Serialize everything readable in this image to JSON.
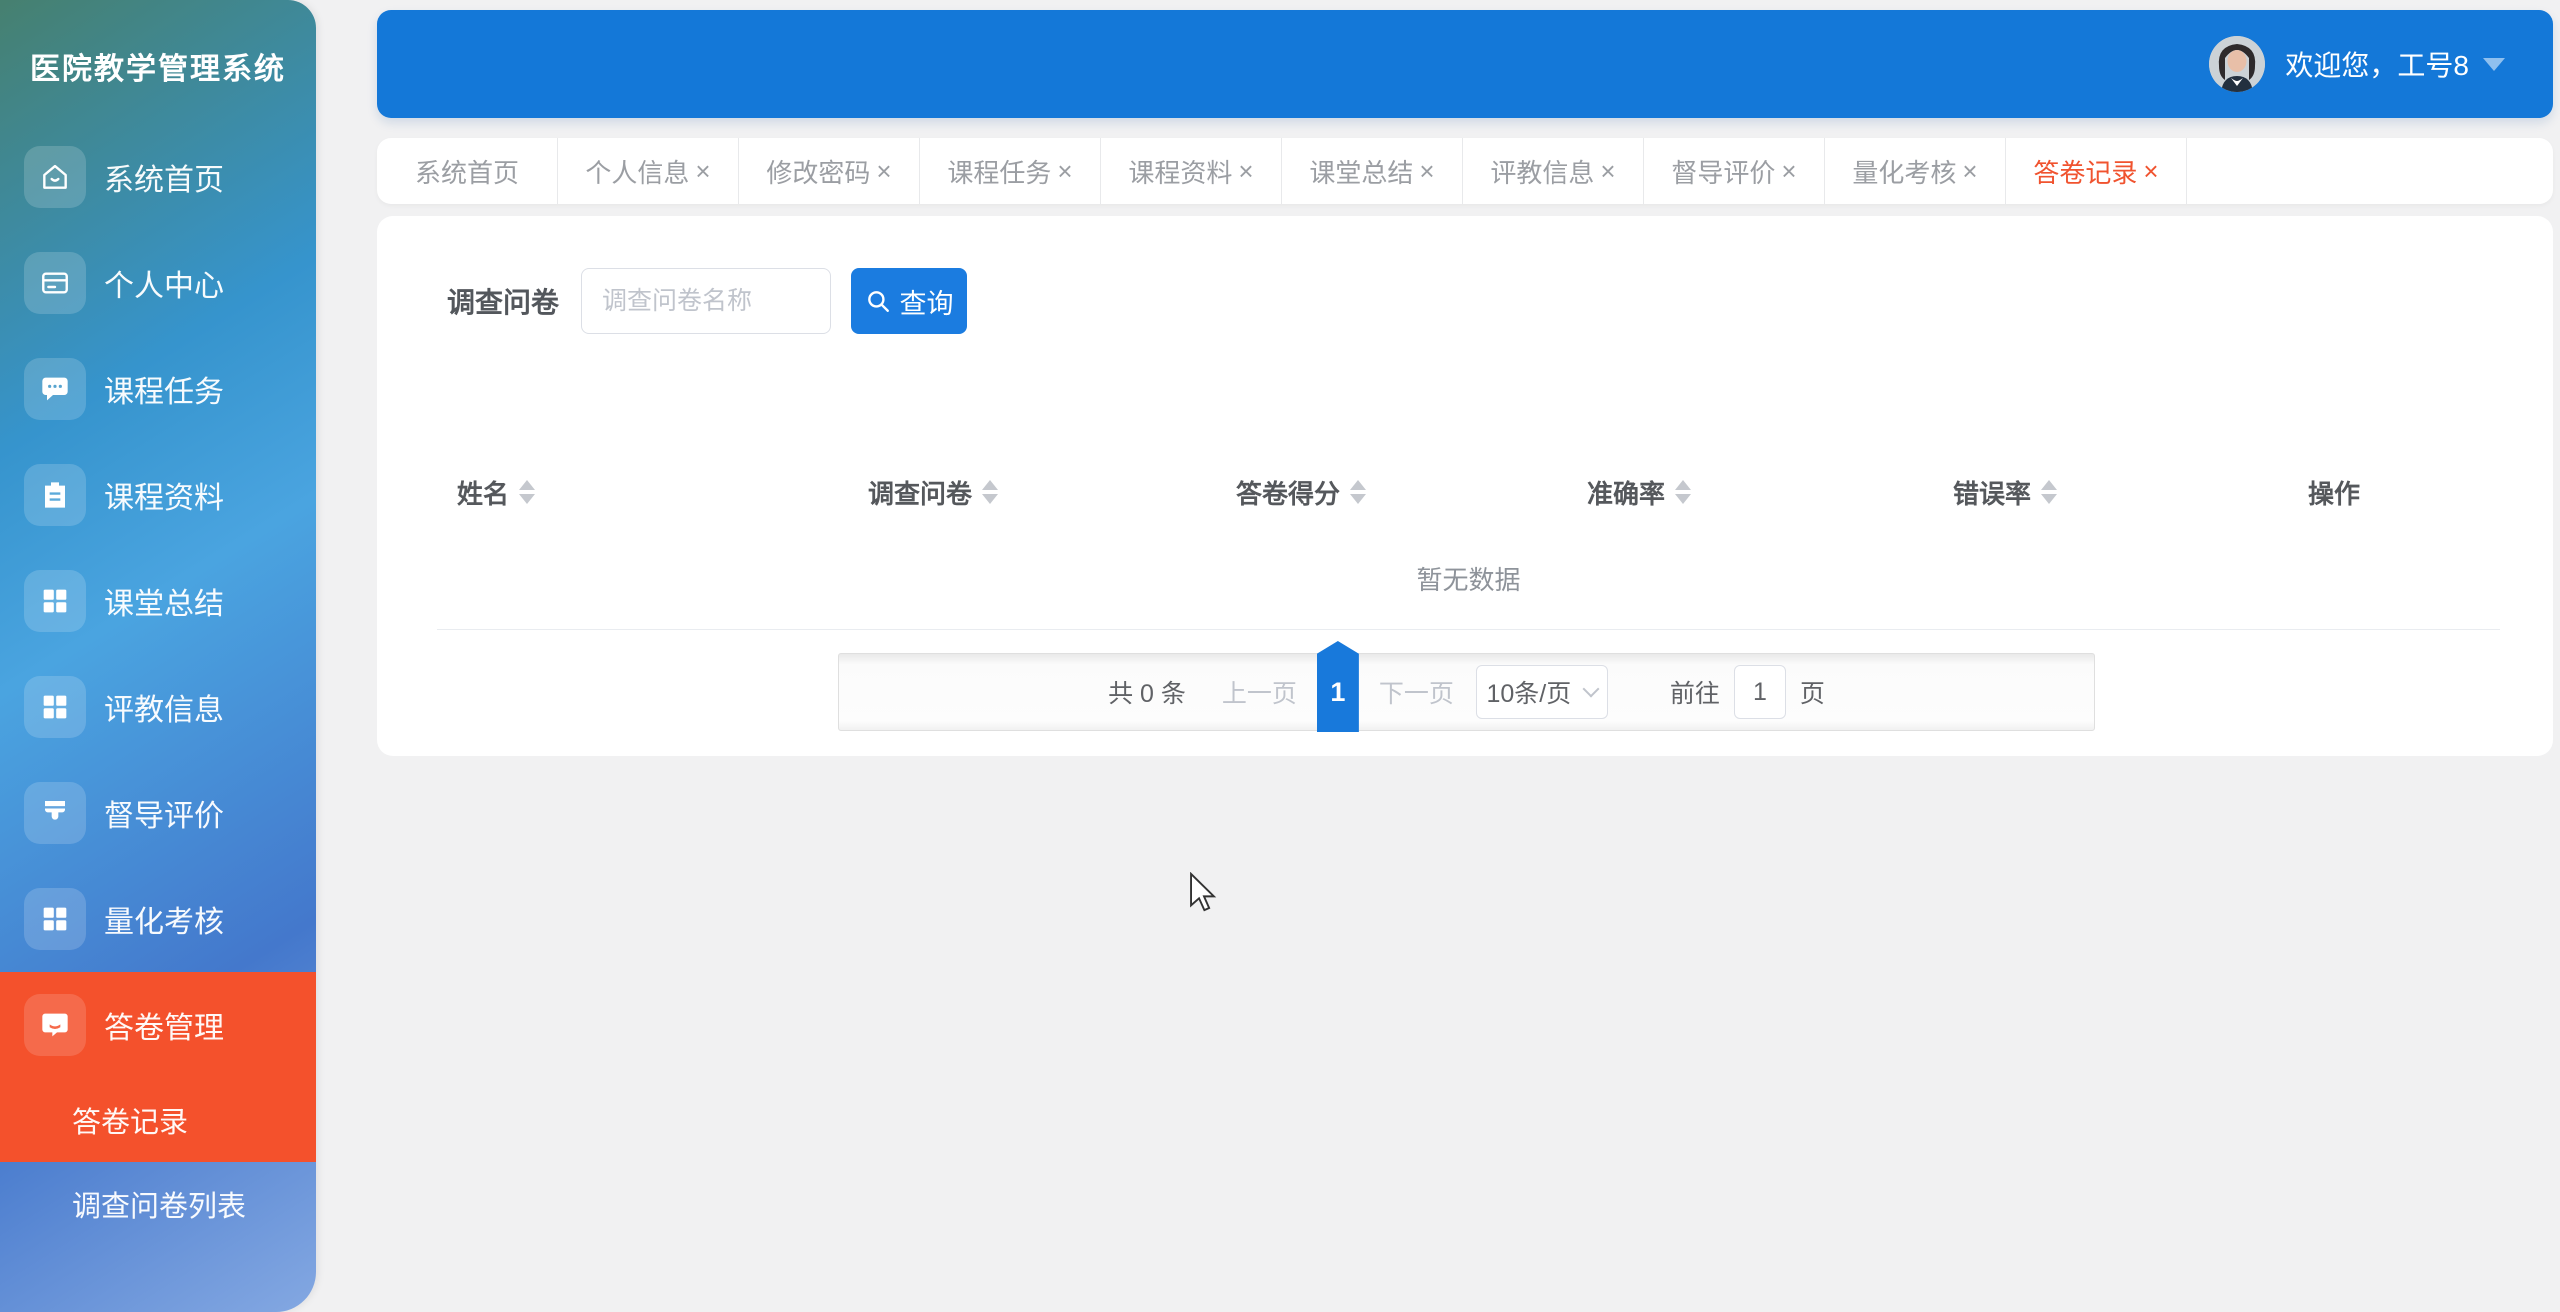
{
  "app": {
    "title": "医院教学管理系统"
  },
  "header": {
    "welcome": "欢迎您，工号8"
  },
  "sidebar": {
    "items": [
      {
        "label": "系统首页",
        "icon": "home-icon"
      },
      {
        "label": "个人中心",
        "icon": "card-icon"
      },
      {
        "label": "课程任务",
        "icon": "chat-icon"
      },
      {
        "label": "课程资料",
        "icon": "clipboard-icon"
      },
      {
        "label": "课堂总结",
        "icon": "grid-icon"
      },
      {
        "label": "评教信息",
        "icon": "grid-icon"
      },
      {
        "label": "督导评价",
        "icon": "brush-icon"
      },
      {
        "label": "量化考核",
        "icon": "grid-icon"
      },
      {
        "label": "答卷管理",
        "icon": "answer-icon",
        "active": true,
        "children": [
          {
            "label": "答卷记录",
            "active": true
          },
          {
            "label": "调查问卷列表",
            "active": false
          }
        ]
      }
    ]
  },
  "tabs": [
    {
      "label": "系统首页",
      "closable": false,
      "active": false
    },
    {
      "label": "个人信息",
      "closable": true,
      "active": false
    },
    {
      "label": "修改密码",
      "closable": true,
      "active": false
    },
    {
      "label": "课程任务",
      "closable": true,
      "active": false
    },
    {
      "label": "课程资料",
      "closable": true,
      "active": false
    },
    {
      "label": "课堂总结",
      "closable": true,
      "active": false
    },
    {
      "label": "评教信息",
      "closable": true,
      "active": false
    },
    {
      "label": "督导评价",
      "closable": true,
      "active": false
    },
    {
      "label": "量化考核",
      "closable": true,
      "active": false
    },
    {
      "label": "答卷记录",
      "closable": true,
      "active": true
    }
  ],
  "search": {
    "label": "调查问卷",
    "placeholder": "调查问卷名称",
    "button": "查询"
  },
  "table": {
    "columns": [
      {
        "label": "姓名",
        "sortable": true
      },
      {
        "label": "调查问卷",
        "sortable": true
      },
      {
        "label": "答卷得分",
        "sortable": true
      },
      {
        "label": "准确率",
        "sortable": true
      },
      {
        "label": "错误率",
        "sortable": true
      },
      {
        "label": "操作",
        "sortable": false
      }
    ],
    "empty_text": "暂无数据",
    "rows": []
  },
  "pagination": {
    "total": "共 0 条",
    "prev": "上一页",
    "page": "1",
    "next": "下一页",
    "page_size": "10条/页",
    "goto": "前往",
    "goto_value": "1",
    "unit": "页"
  },
  "ui": {
    "close_glyph": "×"
  },
  "colors": {
    "header_blue": "#1478d8",
    "button_blue": "#1b7ce0",
    "active_orange": "#f4512c",
    "active_tab_red": "#f0532f",
    "sidebar_gradient_start": "#46806f",
    "sidebar_gradient_mid": "#4aa4e0",
    "sidebar_gradient_end": "#84a8e2"
  }
}
